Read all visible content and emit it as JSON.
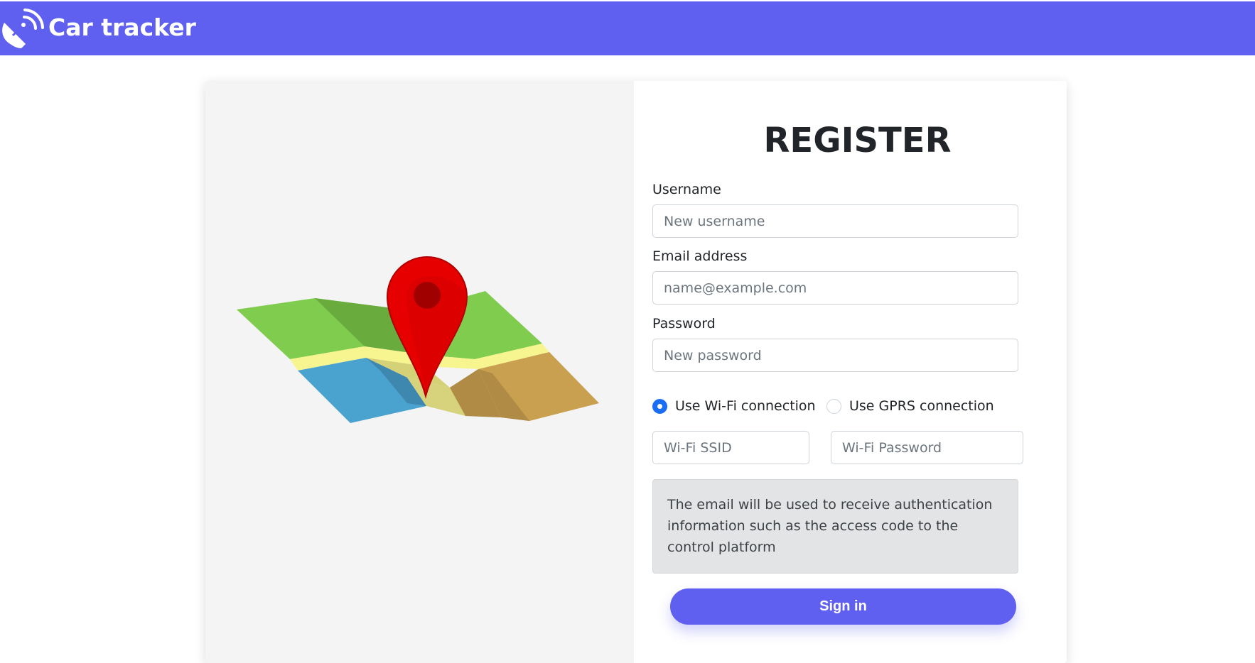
{
  "navbar": {
    "title": "Car tracker",
    "icon": "satellite-dish-icon",
    "background": "#6060f0"
  },
  "illustration": {
    "icon": "map-pin-icon",
    "pin_color": "#e60000"
  },
  "form": {
    "title": "REGISTER",
    "username": {
      "label": "Username",
      "placeholder": "New username",
      "value": ""
    },
    "email": {
      "label": "Email address",
      "placeholder": "name@example.com",
      "value": ""
    },
    "password": {
      "label": "Password",
      "placeholder": "New password",
      "value": ""
    },
    "connection": {
      "options": [
        {
          "label": "Use Wi-Fi connection",
          "checked": true
        },
        {
          "label": "Use GPRS connection",
          "checked": false
        }
      ]
    },
    "wifi_ssid": {
      "placeholder": "Wi-Fi SSID",
      "value": ""
    },
    "wifi_password": {
      "placeholder": "Wi-Fi Password",
      "value": ""
    },
    "info_text": "The email will be used to receive authentication information such as the access code to the control platform",
    "submit_label": "Sign in",
    "accent_color": "#5f5ff0"
  }
}
